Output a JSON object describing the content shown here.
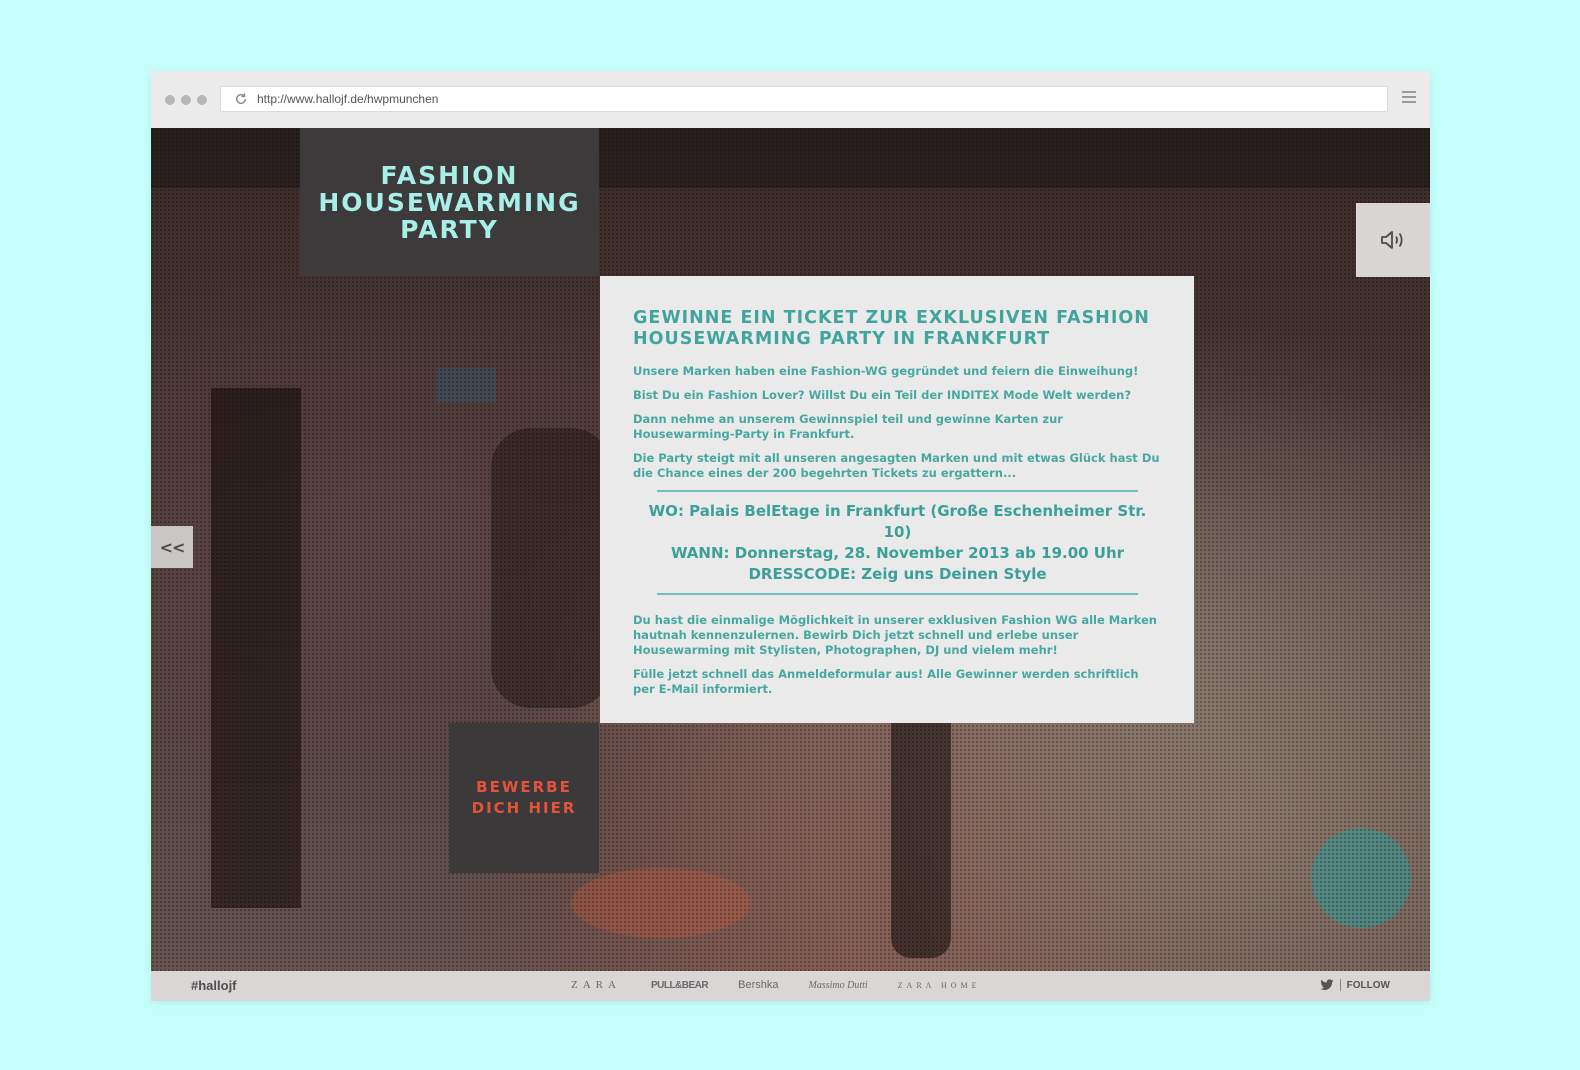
{
  "browser": {
    "url": "http://www.hallojf.de/hwpmunchen"
  },
  "logo": {
    "lines": [
      "FASHION",
      "HOUSEWARMING",
      "PARTY"
    ]
  },
  "card": {
    "title": "GEWINNE EIN TICKET ZUR EXKLUSIVEN FASHION HOUSEWARMING PARTY IN FRANKFURT",
    "paragraphs": [
      "Unsere Marken haben eine Fashion-WG gegründet und feiern die Einweihung!",
      "Bist Du ein Fashion Lover? Willst Du ein Teil der INDITEX Mode Welt werden?",
      "Dann nehme an unserem Gewinnspiel teil und gewinne Karten zur Housewarming-Party in Frankfurt.",
      "Die Party steigt mit all unseren angesagten Marken und mit etwas Glück hast Du die Chance eines der 200 begehrten Tickets zu ergattern..."
    ],
    "details": [
      "WO: Palais BelEtage in Frankfurt (Große Eschenheimer Str. 10)",
      "WANN: Donnerstag, 28. November 2013 ab 19.00 Uhr",
      "DRESSCODE: Zeig uns Deinen Style"
    ],
    "closing": [
      "Du hast die einmalige Möglichkeit in unserer exklusiven Fashion WG alle Marken hautnah kennenzulernen. Bewirb Dich jetzt schnell und erlebe unser Housewarming mit Stylisten, Photographen, DJ und vielem mehr!",
      "Fülle jetzt schnell das Anmeldeformular aus! Alle Gewinner werden schriftlich per E-Mail informiert."
    ]
  },
  "cta": {
    "lines": [
      "BEWERBE",
      "DICH HIER"
    ]
  },
  "back_button": {
    "label": "<<"
  },
  "footer": {
    "hashtag": "#hallojf",
    "brands": [
      "ZARA",
      "PULL&BEAR",
      "Bershka",
      "Massimo Dutti",
      "ZARA HOME"
    ],
    "follow": "FOLLOW"
  },
  "colors": {
    "page_bg": "#c5fffb",
    "accent_teal": "#41a59e",
    "cta_red": "#e5523a",
    "logo_text": "#a8efe8"
  }
}
